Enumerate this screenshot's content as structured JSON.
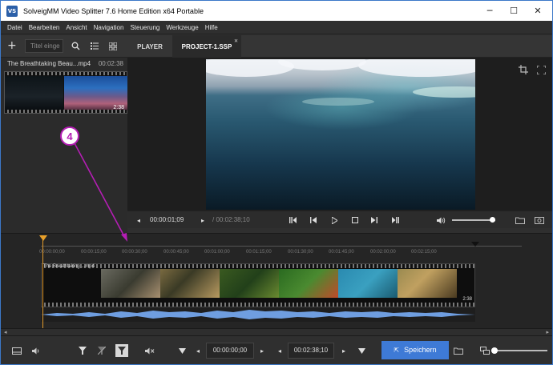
{
  "window": {
    "title": "SolveigMM Video Splitter 7.6 Home Edition x64 Portable",
    "app_icon_text": "VS",
    "minimize": "─",
    "maximize": "☐",
    "close": "✕"
  },
  "menu": [
    "Datei",
    "Bearbeiten",
    "Ansicht",
    "Navigation",
    "Steuerung",
    "Werkzeuge",
    "Hilfe"
  ],
  "library": {
    "add_label": "+",
    "search_placeholder": "Titel einge",
    "clip": {
      "name": "The Breathtaking Beau...mp4",
      "duration": "00:02:38",
      "thumb_duration": "2:38"
    }
  },
  "tabs": [
    {
      "label": "PLAYER",
      "active": false
    },
    {
      "label": "PROJECT-1.SSP",
      "active": true,
      "close": "✕"
    }
  ],
  "transport": {
    "current_time": "00:00:01;09",
    "total_time": "/ 00:02:38;10"
  },
  "timeline": {
    "tick_labels": [
      "00:00:00;00",
      "00:00:15;00",
      "00:00:30;00",
      "00:00:45;00",
      "00:01:00;00",
      "00:01:15;00",
      "00:01:30;00",
      "00:01:45;00",
      "00:02:00;00",
      "00:02:15;00"
    ],
    "track_label": "The Breathtaking ...mp4",
    "track_duration": "2:38"
  },
  "bottom": {
    "start_timecode": "00:00:00;00",
    "end_timecode": "00:02:38;10",
    "save_label": "Speichern"
  },
  "annotation": {
    "number": "4",
    "color": "#b41eb4"
  },
  "colors": {
    "accent": "#3e7ad6",
    "playhead": "#e39a2a",
    "waveform": "#6f9ee0"
  }
}
